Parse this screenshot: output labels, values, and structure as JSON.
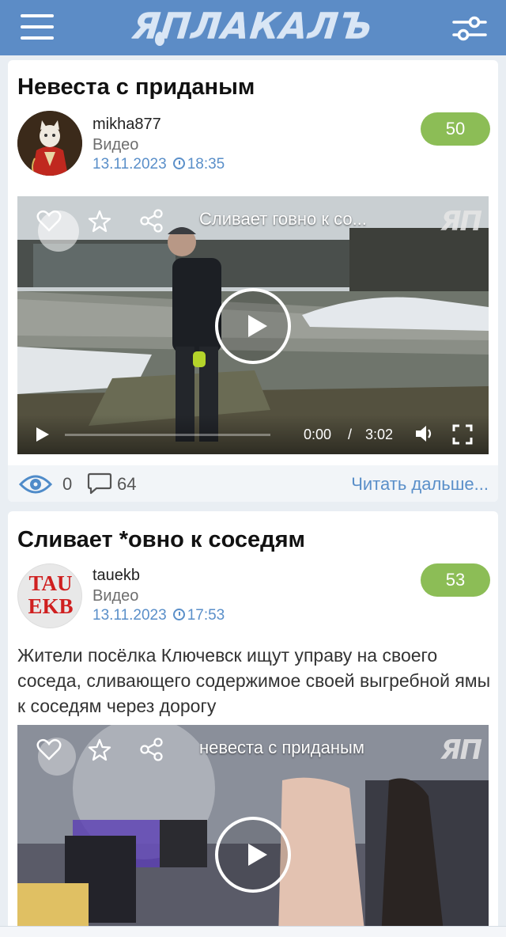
{
  "header": {
    "logo_text": "ЯПЛАКАЛЪ",
    "menu_icon": "hamburger-icon",
    "filter_icon": "sliders-icon",
    "brand_color": "#5c8cc6"
  },
  "posts": [
    {
      "title": "Невеста с приданым",
      "author": "mikha877",
      "category": "Видео",
      "date": "13.11.2023",
      "time": "18:35",
      "rating": "50",
      "video": {
        "caption": "Сливает говно к со...",
        "watermark": "ЯП",
        "current_time": "0:00",
        "separator": "/",
        "duration": "3:02"
      },
      "stats": {
        "views": "0",
        "comments": "64",
        "read_more": "Читать дальше..."
      }
    },
    {
      "title": "Сливает *овно к соседям",
      "author": "tauekb",
      "category": "Видео",
      "date": "13.11.2023",
      "time": "17:53",
      "rating": "53",
      "avatar_text": [
        "TAU",
        "EKB"
      ],
      "excerpt": "Жители посёлка Ключевск ищут управу на своего соседа, сливающего содержимое своей выгребной ямы к соседям через дорогу",
      "video": {
        "caption": "невеста с приданым",
        "watermark": "ЯП"
      }
    }
  ],
  "colors": {
    "rating_bg": "#8cbd56",
    "link": "#5a8fc9"
  }
}
